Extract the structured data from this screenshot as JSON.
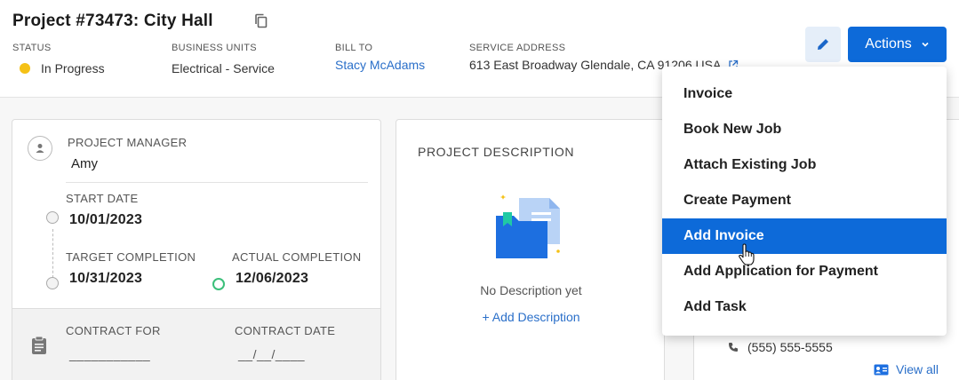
{
  "header": {
    "title": "Project #73473:  City Hall",
    "meta": {
      "status_label": "STATUS",
      "status_value": "In Progress",
      "business_units_label": "BUSINESS UNITS",
      "business_units_value": "Electrical - Service",
      "bill_to_label": "BILL TO",
      "bill_to_value": "Stacy McAdams",
      "service_address_label": "SERVICE ADDRESS",
      "service_address_value": "613 East Broadway Glendale, CA 91206 USA"
    },
    "actions_label": "Actions"
  },
  "project_card": {
    "manager_label": "PROJECT MANAGER",
    "manager_value": "Amy",
    "start_label": "START DATE",
    "start_value": "10/01/2023",
    "target_label": "TARGET COMPLETION",
    "target_value": "10/31/2023",
    "actual_label": "ACTUAL COMPLETION",
    "actual_value": "12/06/2023",
    "contract_for_label": "CONTRACT FOR",
    "contract_for_value": "___________",
    "contract_date_label": "CONTRACT DATE",
    "contract_date_value": "__/__/____"
  },
  "description_card": {
    "title": "PROJECT DESCRIPTION",
    "empty_text": "No Description yet",
    "add_link": "+ Add Description"
  },
  "contact_card": {
    "phone": "(555) 555-5555",
    "view_all": "View all"
  },
  "actions_menu": {
    "items": [
      {
        "label": "Invoice"
      },
      {
        "label": "Book New Job"
      },
      {
        "label": "Attach Existing Job"
      },
      {
        "label": "Create Payment"
      },
      {
        "label": "Add Invoice"
      },
      {
        "label": "Add Application for Payment"
      },
      {
        "label": "Add Task"
      }
    ],
    "active_index": 4
  },
  "colors": {
    "primary": "#0d6ad9",
    "link": "#2a6fc9",
    "status_in_progress": "#f5c116",
    "completion_green": "#3bbf7a"
  },
  "icons": [
    "copy-icon",
    "external-link-icon",
    "pencil-icon",
    "chevron-down-icon",
    "person-icon",
    "clipboard-icon",
    "folder-document-icon",
    "phone-icon",
    "contact-card-icon",
    "hand-cursor-icon"
  ]
}
